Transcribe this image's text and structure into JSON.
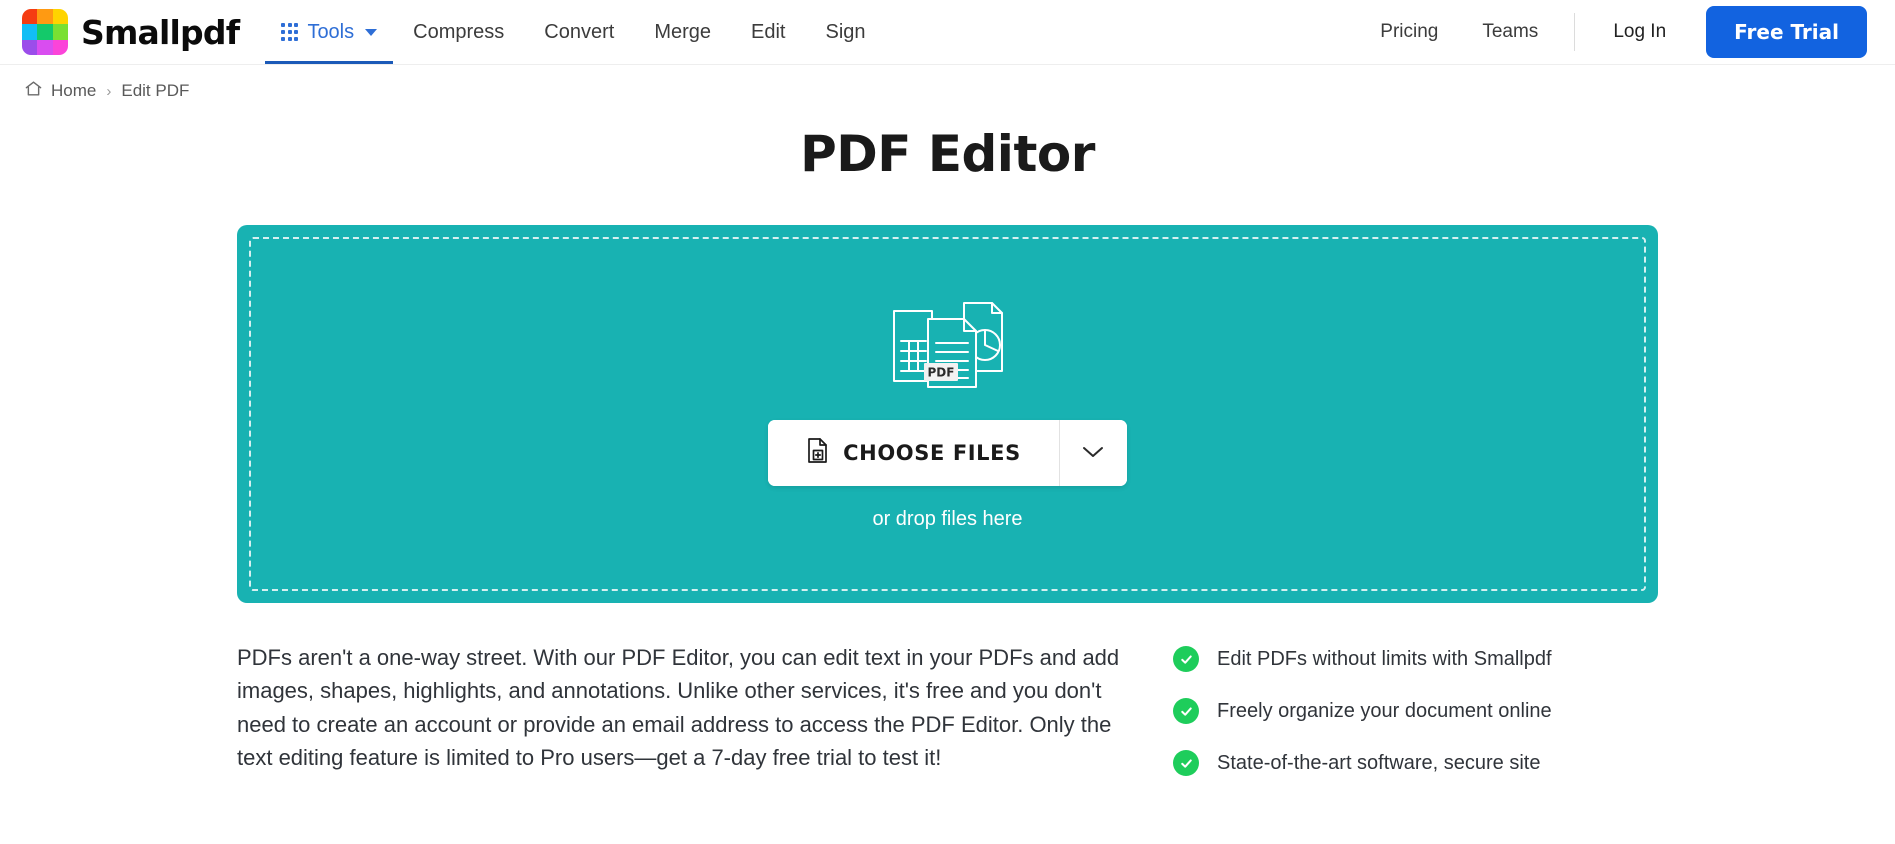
{
  "brand": {
    "name": "Smallpdf",
    "logo_colors": [
      "#f53c12",
      "#ff9a12",
      "#ffd400",
      "#12bef5",
      "#14c96a",
      "#7ae033",
      "#9b4dea",
      "#d94df0",
      "#fb44d9"
    ],
    "accent_blue": "#2e6ed6",
    "cta_blue": "#1263e0",
    "teal": "#18b2b2",
    "green": "#1ecd5b"
  },
  "header": {
    "tools": {
      "label": "Tools",
      "icon": "grid-icon",
      "caret": "chevron-down-icon"
    },
    "nav": [
      {
        "label": "Compress"
      },
      {
        "label": "Convert"
      },
      {
        "label": "Merge"
      },
      {
        "label": "Edit"
      },
      {
        "label": "Sign"
      }
    ],
    "right_links": [
      {
        "label": "Pricing"
      },
      {
        "label": "Teams"
      }
    ],
    "login_label": "Log In",
    "trial_label": "Free Trial"
  },
  "breadcrumb": {
    "home_icon": "home-icon",
    "home_label": "Home",
    "separator": "›",
    "current_label": "Edit PDF"
  },
  "page": {
    "title": "PDF Editor"
  },
  "dropzone": {
    "icon": "documents-pdf-icon",
    "pdf_badge": "PDF",
    "choose_label": "CHOOSE FILES",
    "choose_icon": "file-plus-icon",
    "caret_icon": "chevron-down-icon",
    "drop_hint": "or drop files here"
  },
  "description": {
    "text": "PDFs aren't a one-way street. With our PDF Editor, you can edit text in your PDFs and add images, shapes, highlights, and annotations. Unlike other services, it's free and you don't need to create an account or provide an email address to access the PDF Editor. Only the text editing feature is limited to Pro users—get a 7-day free trial to test it!"
  },
  "features": [
    {
      "label": "Edit PDFs without limits with Smallpdf"
    },
    {
      "label": "Freely organize your document online"
    },
    {
      "label": "State-of-the-art software, secure site"
    }
  ]
}
